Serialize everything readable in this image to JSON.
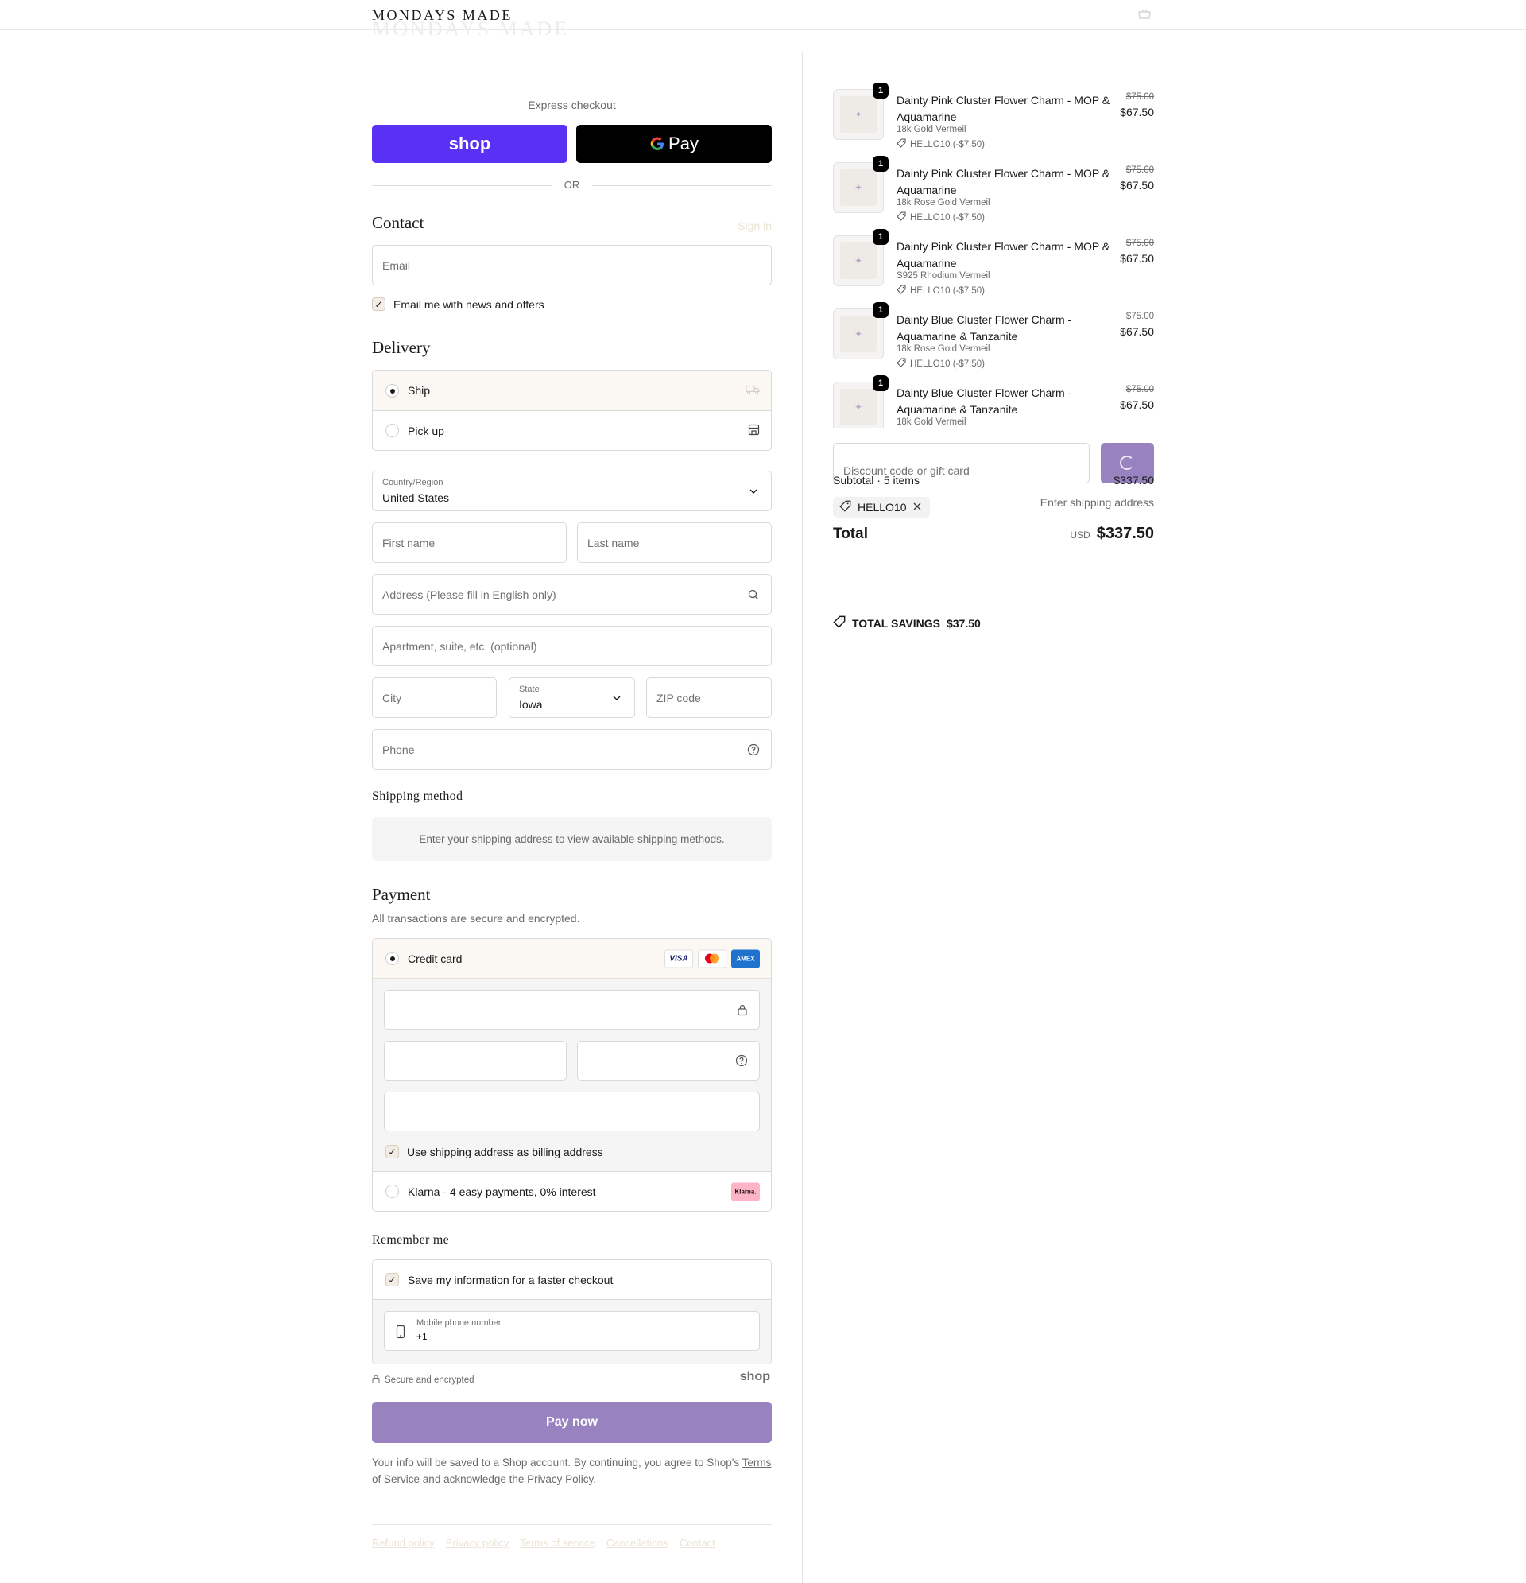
{
  "header": {
    "brand": "MONDAYS MADE"
  },
  "express": {
    "title": "Express checkout",
    "shop_label": "shop",
    "gpay_label": "Pay",
    "or_label": "OR"
  },
  "contact": {
    "heading": "Contact",
    "sign_in": "Sign in",
    "email_placeholder": "Email",
    "news_label": "Email me with news and offers"
  },
  "delivery": {
    "heading": "Delivery",
    "options": [
      {
        "label": "Ship",
        "selected": true
      },
      {
        "label": "Pick up",
        "selected": false
      }
    ],
    "country_label": "Country/Region",
    "country_value": "United States",
    "first_name_placeholder": "First name",
    "last_name_placeholder": "Last name",
    "address_placeholder": "Address (Please fill in English only)",
    "apartment_placeholder": "Apartment, suite, etc. (optional)",
    "city_placeholder": "City",
    "state_label": "State",
    "state_value": "Iowa",
    "zip_placeholder": "ZIP code",
    "phone_placeholder": "Phone"
  },
  "shipping_method": {
    "heading": "Shipping method",
    "message": "Enter your shipping address to view available shipping methods."
  },
  "payment": {
    "heading": "Payment",
    "note": "All transactions are secure and encrypted.",
    "credit_card_label": "Credit card",
    "card_brands": [
      "VISA",
      "Mastercard",
      "AMEX"
    ],
    "billing_label": "Use shipping address as billing address",
    "klarna_label": "Klarna - 4 easy payments, 0% interest",
    "klarna_badge": "Klarna."
  },
  "remember": {
    "heading": "Remember me",
    "save_label": "Save my information for a faster checkout",
    "mobile_label": "Mobile phone number",
    "mobile_value": "+1"
  },
  "secure": {
    "label": "Secure and encrypted",
    "shop_brand": "shop"
  },
  "pay_button": "Pay now",
  "legal": {
    "text_1": "Your info will be saved to a Shop account. By continuing, you agree to Shop's",
    "terms": "Terms of Service",
    "text_2": "and acknowledge the",
    "privacy": "Privacy Policy",
    "text_3": "."
  },
  "footer_links": [
    "Refund policy",
    "Privacy policy",
    "Terms of service",
    "Cancellations",
    "Contact"
  ],
  "order": {
    "items": [
      {
        "qty": "1",
        "title": "Dainty Pink Cluster Flower Charm - MOP & Aquamarine",
        "variant": "18k Gold Vermeil",
        "discount": "HELLO10 (-$7.50)",
        "old_price": "$75.00",
        "price": "$67.50"
      },
      {
        "qty": "1",
        "title": "Dainty Pink Cluster Flower Charm - MOP & Aquamarine",
        "variant": "18k Rose Gold Vermeil",
        "discount": "HELLO10 (-$7.50)",
        "old_price": "$75.00",
        "price": "$67.50"
      },
      {
        "qty": "1",
        "title": "Dainty Pink Cluster Flower Charm - MOP & Aquamarine",
        "variant": "S925 Rhodium Vermeil",
        "discount": "HELLO10 (-$7.50)",
        "old_price": "$75.00",
        "price": "$67.50"
      },
      {
        "qty": "1",
        "title": "Dainty Blue Cluster Flower Charm - Aquamarine & Tanzanite",
        "variant": "18k Rose Gold Vermeil",
        "discount": "HELLO10 (-$7.50)",
        "old_price": "$75.00",
        "price": "$67.50"
      },
      {
        "qty": "1",
        "title": "Dainty Blue Cluster Flower Charm - Aquamarine & Tanzanite",
        "variant": "18k Gold Vermeil",
        "discount": "",
        "old_price": "$75.00",
        "price": "$67.50"
      }
    ],
    "discount_placeholder": "Discount code or gift card",
    "subtotal_label": "Subtotal · 5 items",
    "subtotal_value": "$337.50",
    "applied_code": "HELLO10",
    "shipping_label": "Enter shipping address",
    "total_label": "Total",
    "currency": "USD",
    "total_value": "$337.50",
    "savings_label": "TOTAL SAVINGS",
    "savings_value": "$37.50"
  },
  "colors": {
    "shop_purple": "#5a31f4",
    "pay_button": "#9882bf",
    "selected_bg": "#fbf8f4"
  }
}
